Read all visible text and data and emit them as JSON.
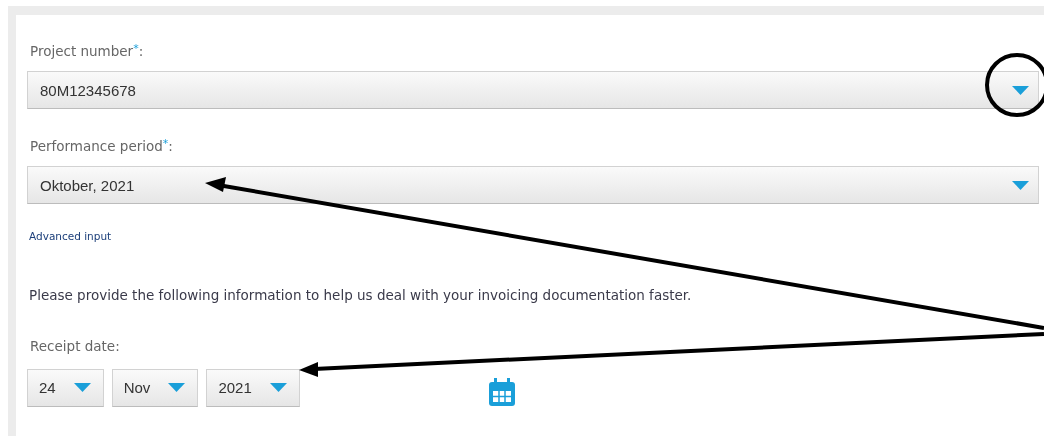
{
  "form": {
    "fields": [
      {
        "label": "Project number$^{*}$:",
        "value": "80M12345678"
      },
      {
        "label": "Performance period$^{*}$:",
        "value": "Oktober, 2021",
        "link": "Advanced input"
      }
    ],
    "note": "Please provide the following information to help us deal with your invoicing documentation faster.",
    "receipt_date": {
      "label": "Receipt date:",
      "parts": [
        {
          "value": "24"
        },
        {
          "value": "Nov"
        },
        {
          "value": "2021"
        }
      ]
    }
  }
}
